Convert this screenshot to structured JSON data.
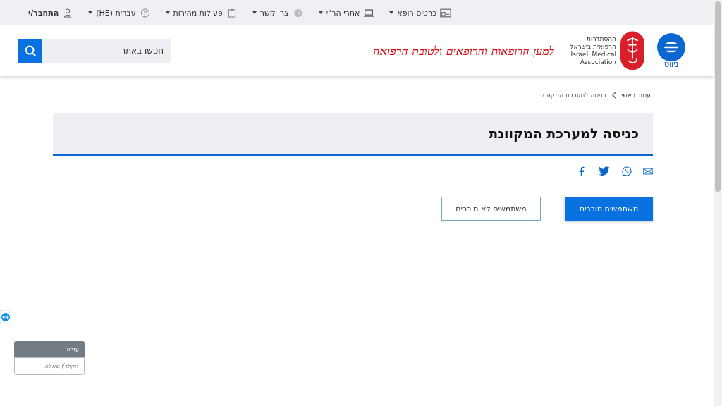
{
  "top_bar": {
    "items": [
      {
        "label": "כרטיס רופא",
        "dropdown": true
      },
      {
        "label": "אתרי הר\"י",
        "dropdown": true
      },
      {
        "label": "צרו קשר",
        "dropdown": true
      },
      {
        "label": "פעולות מהירות",
        "dropdown": true
      },
      {
        "label": "עברית (HE)",
        "dropdown": true
      },
      {
        "label": "התחבר/י",
        "dropdown": false
      }
    ]
  },
  "header": {
    "menu_label": "ניווט",
    "logo_lines": [
      "ההסתדרות",
      "הרפואית בישראל",
      "Israeli Medical",
      "Association"
    ],
    "slogan": "למען הרופאות והרופאים ולטובת הרפואה",
    "search": {
      "placeholder": "חפשו באתר"
    }
  },
  "breadcrumbs": [
    "עמוד ראשי",
    "כניסה למערכת המקוונת"
  ],
  "page_title": "כניסה למערכת המקוונת",
  "buttons": [
    {
      "label": "משתמשים מוכרים",
      "kind": "primary"
    },
    {
      "label": "משתמשים לא מוכרים",
      "kind": "outline"
    }
  ],
  "help_widget": {
    "title": "עזרה",
    "placeholder": "הקלד/י שאלה"
  }
}
